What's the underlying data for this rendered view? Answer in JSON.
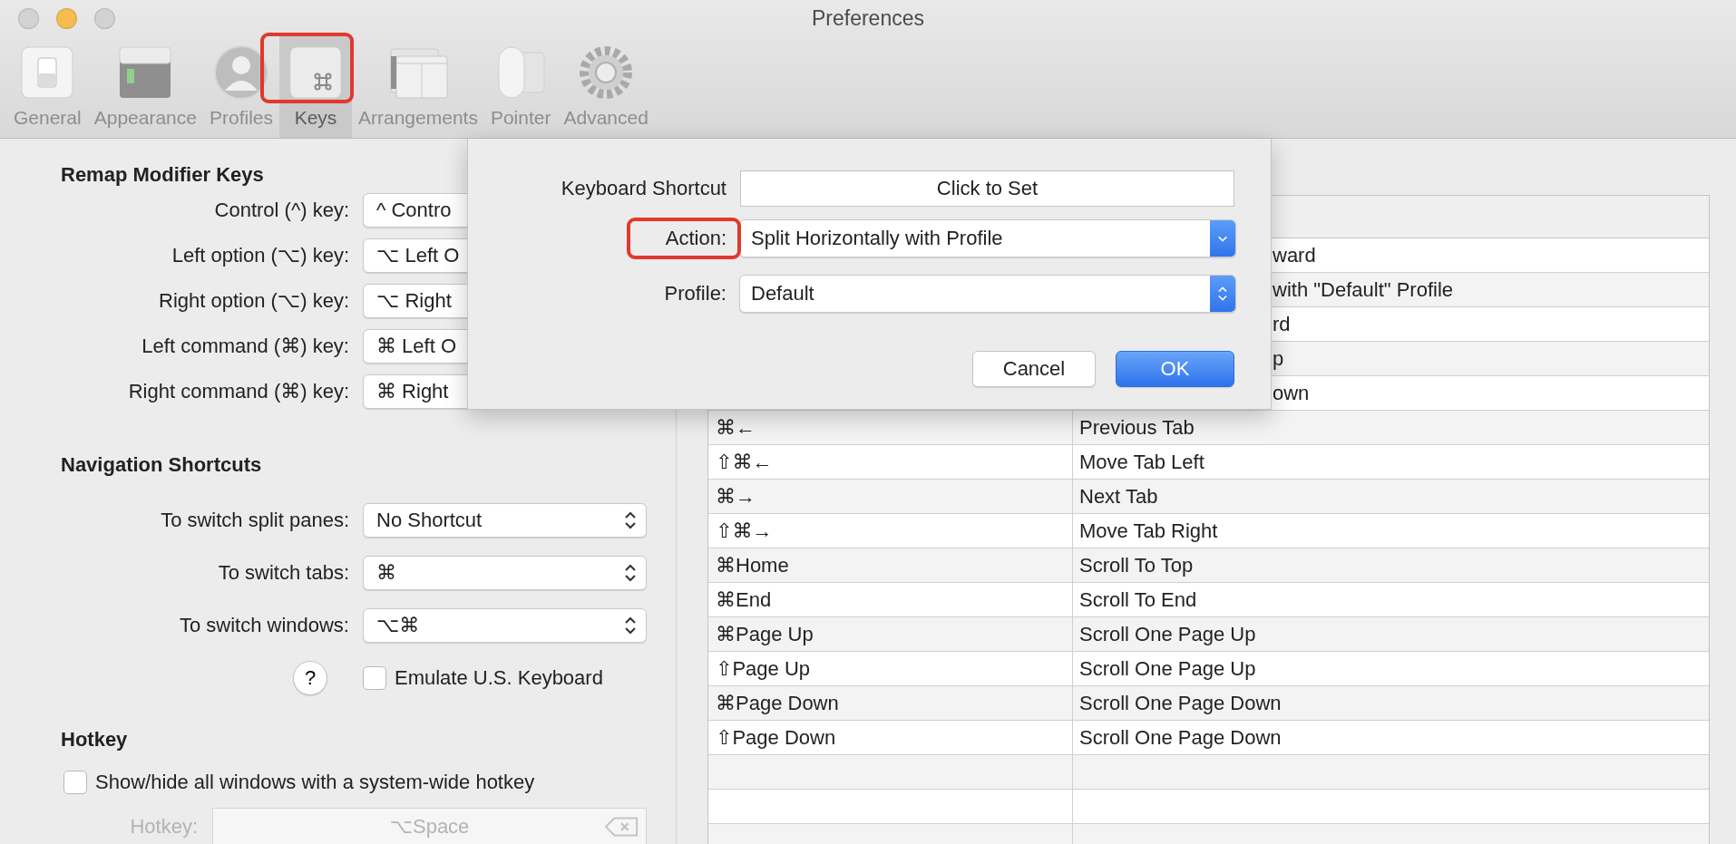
{
  "window": {
    "title": "Preferences"
  },
  "traffic_lights": [
    {
      "color": "#d2d2d2"
    },
    {
      "color": "#f5bd4f"
    },
    {
      "color": "#d2d2d2"
    }
  ],
  "toolbar": {
    "tabs": [
      {
        "label": "General",
        "kind": "switch",
        "selected": false,
        "highlighted": false
      },
      {
        "label": "Appearance",
        "kind": "window",
        "selected": false,
        "highlighted": false
      },
      {
        "label": "Profiles",
        "kind": "person",
        "selected": false,
        "highlighted": false
      },
      {
        "label": "Keys",
        "kind": "key",
        "selected": true,
        "highlighted": true
      },
      {
        "label": "Arrangements",
        "kind": "panes",
        "selected": false,
        "highlighted": false
      },
      {
        "label": "Pointer",
        "kind": "mouse",
        "selected": false,
        "highlighted": false
      },
      {
        "label": "Advanced",
        "kind": "gear",
        "selected": false,
        "highlighted": false
      }
    ]
  },
  "remap": {
    "heading": "Remap Modifier Keys",
    "rows": [
      {
        "label": "Control (^) key:",
        "value": "^ Contro"
      },
      {
        "label": "Left option (⌥) key:",
        "value": "⌥ Left O"
      },
      {
        "label": "Right option (⌥) key:",
        "value": "⌥ Right"
      },
      {
        "label": "Left command (⌘) key:",
        "value": "⌘ Left O"
      },
      {
        "label": "Right command (⌘) key:",
        "value": "⌘ Right"
      }
    ]
  },
  "navigation": {
    "heading": "Navigation Shortcuts",
    "rows": [
      {
        "label": "To switch split panes:",
        "value": "No Shortcut"
      },
      {
        "label": "To switch tabs:",
        "value": "⌘"
      },
      {
        "label": "To switch windows:",
        "value": "⌥⌘"
      }
    ],
    "help_button": "?",
    "emulate": {
      "label": "Emulate U.S. Keyboard",
      "checked": false
    }
  },
  "hotkey": {
    "heading": "Hotkey",
    "toggle": {
      "label": "Show/hide all windows with a system-wide hotkey",
      "checked": false
    },
    "field_label": "Hotkey:",
    "value": "⌥Space",
    "disabled": true
  },
  "table": {
    "rows": [
      {
        "action": "ward"
      },
      {
        "action": "with \"Default\" Profile"
      },
      {
        "action": "rd"
      },
      {
        "action": "p"
      },
      {
        "action": "own"
      },
      {
        "shortcut": "⌘←",
        "action": "Previous Tab"
      },
      {
        "shortcut": "⇧⌘←",
        "action": "Move Tab Left"
      },
      {
        "shortcut": "⌘→",
        "action": "Next Tab"
      },
      {
        "shortcut": "⇧⌘→",
        "action": "Move Tab Right"
      },
      {
        "shortcut": "⌘Home",
        "action": "Scroll To Top"
      },
      {
        "shortcut": "⌘End",
        "action": "Scroll To End"
      },
      {
        "shortcut": "⌘Page Up",
        "action": "Scroll One Page Up"
      },
      {
        "shortcut": "⇧Page Up",
        "action": "Scroll One Page Up"
      },
      {
        "shortcut": "⌘Page Down",
        "action": "Scroll One Page Down"
      },
      {
        "shortcut": "⇧Page Down",
        "action": "Scroll One Page Down"
      }
    ]
  },
  "dialog": {
    "shortcut_label": "Keyboard Shortcut",
    "shortcut_button": "Click to Set",
    "action_label": "Action:",
    "action_highlighted": true,
    "action_value": "Split Horizontally with Profile",
    "profile_label": "Profile:",
    "profile_value": "Default",
    "buttons": [
      {
        "label": "Cancel",
        "default": false
      },
      {
        "label": "OK",
        "default": true
      }
    ]
  }
}
